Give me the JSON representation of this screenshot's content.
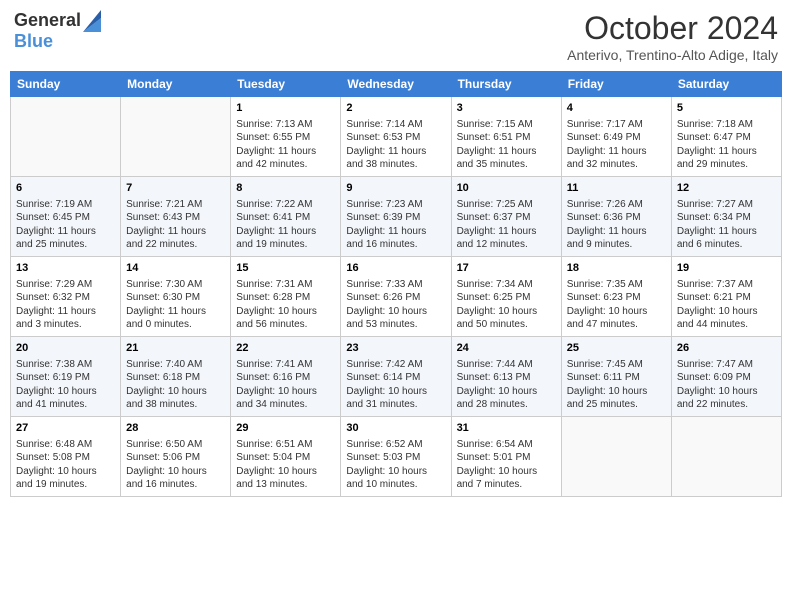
{
  "header": {
    "logo_general": "General",
    "logo_blue": "Blue",
    "month_year": "October 2024",
    "location": "Anterivo, Trentino-Alto Adige, Italy"
  },
  "weekdays": [
    "Sunday",
    "Monday",
    "Tuesday",
    "Wednesday",
    "Thursday",
    "Friday",
    "Saturday"
  ],
  "weeks": [
    [
      {
        "day": "",
        "info": ""
      },
      {
        "day": "",
        "info": ""
      },
      {
        "day": "1",
        "info": "Sunrise: 7:13 AM\nSunset: 6:55 PM\nDaylight: 11 hours and 42 minutes."
      },
      {
        "day": "2",
        "info": "Sunrise: 7:14 AM\nSunset: 6:53 PM\nDaylight: 11 hours and 38 minutes."
      },
      {
        "day": "3",
        "info": "Sunrise: 7:15 AM\nSunset: 6:51 PM\nDaylight: 11 hours and 35 minutes."
      },
      {
        "day": "4",
        "info": "Sunrise: 7:17 AM\nSunset: 6:49 PM\nDaylight: 11 hours and 32 minutes."
      },
      {
        "day": "5",
        "info": "Sunrise: 7:18 AM\nSunset: 6:47 PM\nDaylight: 11 hours and 29 minutes."
      }
    ],
    [
      {
        "day": "6",
        "info": "Sunrise: 7:19 AM\nSunset: 6:45 PM\nDaylight: 11 hours and 25 minutes."
      },
      {
        "day": "7",
        "info": "Sunrise: 7:21 AM\nSunset: 6:43 PM\nDaylight: 11 hours and 22 minutes."
      },
      {
        "day": "8",
        "info": "Sunrise: 7:22 AM\nSunset: 6:41 PM\nDaylight: 11 hours and 19 minutes."
      },
      {
        "day": "9",
        "info": "Sunrise: 7:23 AM\nSunset: 6:39 PM\nDaylight: 11 hours and 16 minutes."
      },
      {
        "day": "10",
        "info": "Sunrise: 7:25 AM\nSunset: 6:37 PM\nDaylight: 11 hours and 12 minutes."
      },
      {
        "day": "11",
        "info": "Sunrise: 7:26 AM\nSunset: 6:36 PM\nDaylight: 11 hours and 9 minutes."
      },
      {
        "day": "12",
        "info": "Sunrise: 7:27 AM\nSunset: 6:34 PM\nDaylight: 11 hours and 6 minutes."
      }
    ],
    [
      {
        "day": "13",
        "info": "Sunrise: 7:29 AM\nSunset: 6:32 PM\nDaylight: 11 hours and 3 minutes."
      },
      {
        "day": "14",
        "info": "Sunrise: 7:30 AM\nSunset: 6:30 PM\nDaylight: 11 hours and 0 minutes."
      },
      {
        "day": "15",
        "info": "Sunrise: 7:31 AM\nSunset: 6:28 PM\nDaylight: 10 hours and 56 minutes."
      },
      {
        "day": "16",
        "info": "Sunrise: 7:33 AM\nSunset: 6:26 PM\nDaylight: 10 hours and 53 minutes."
      },
      {
        "day": "17",
        "info": "Sunrise: 7:34 AM\nSunset: 6:25 PM\nDaylight: 10 hours and 50 minutes."
      },
      {
        "day": "18",
        "info": "Sunrise: 7:35 AM\nSunset: 6:23 PM\nDaylight: 10 hours and 47 minutes."
      },
      {
        "day": "19",
        "info": "Sunrise: 7:37 AM\nSunset: 6:21 PM\nDaylight: 10 hours and 44 minutes."
      }
    ],
    [
      {
        "day": "20",
        "info": "Sunrise: 7:38 AM\nSunset: 6:19 PM\nDaylight: 10 hours and 41 minutes."
      },
      {
        "day": "21",
        "info": "Sunrise: 7:40 AM\nSunset: 6:18 PM\nDaylight: 10 hours and 38 minutes."
      },
      {
        "day": "22",
        "info": "Sunrise: 7:41 AM\nSunset: 6:16 PM\nDaylight: 10 hours and 34 minutes."
      },
      {
        "day": "23",
        "info": "Sunrise: 7:42 AM\nSunset: 6:14 PM\nDaylight: 10 hours and 31 minutes."
      },
      {
        "day": "24",
        "info": "Sunrise: 7:44 AM\nSunset: 6:13 PM\nDaylight: 10 hours and 28 minutes."
      },
      {
        "day": "25",
        "info": "Sunrise: 7:45 AM\nSunset: 6:11 PM\nDaylight: 10 hours and 25 minutes."
      },
      {
        "day": "26",
        "info": "Sunrise: 7:47 AM\nSunset: 6:09 PM\nDaylight: 10 hours and 22 minutes."
      }
    ],
    [
      {
        "day": "27",
        "info": "Sunrise: 6:48 AM\nSunset: 5:08 PM\nDaylight: 10 hours and 19 minutes."
      },
      {
        "day": "28",
        "info": "Sunrise: 6:50 AM\nSunset: 5:06 PM\nDaylight: 10 hours and 16 minutes."
      },
      {
        "day": "29",
        "info": "Sunrise: 6:51 AM\nSunset: 5:04 PM\nDaylight: 10 hours and 13 minutes."
      },
      {
        "day": "30",
        "info": "Sunrise: 6:52 AM\nSunset: 5:03 PM\nDaylight: 10 hours and 10 minutes."
      },
      {
        "day": "31",
        "info": "Sunrise: 6:54 AM\nSunset: 5:01 PM\nDaylight: 10 hours and 7 minutes."
      },
      {
        "day": "",
        "info": ""
      },
      {
        "day": "",
        "info": ""
      }
    ]
  ]
}
